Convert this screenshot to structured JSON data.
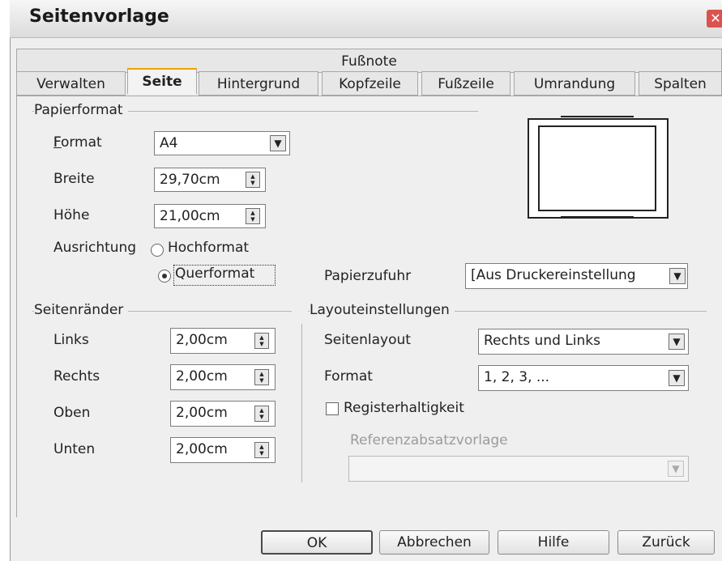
{
  "window": {
    "title": "Seitenvorlage",
    "close_glyph": "✕"
  },
  "tabs": {
    "row1": [
      "Fußnote"
    ],
    "row2": [
      "Verwalten",
      "Seite",
      "Hintergrund",
      "Kopfzeile",
      "Fußzeile",
      "Umrandung",
      "Spalten"
    ],
    "active": "Seite"
  },
  "papierformat": {
    "heading": "Papierformat",
    "format_label": "Format",
    "format_value": "A4",
    "breite_label": "Breite",
    "breite_value": "29,70cm",
    "hoehe_label": "Höhe",
    "hoehe_value": "21,00cm",
    "ausrichtung_label": "Ausrichtung",
    "orientation_options": [
      "Hochformat",
      "Querformat"
    ],
    "orientation_selected": "Querformat",
    "papierzufuhr_label": "Papierzufuhr",
    "papierzufuhr_value": "[Aus Druckereinstellung"
  },
  "seitenraender": {
    "heading": "Seitenränder",
    "links_label": "Links",
    "links_value": "2,00cm",
    "rechts_label": "Rechts",
    "rechts_value": "2,00cm",
    "oben_label": "Oben",
    "oben_value": "2,00cm",
    "unten_label": "Unten",
    "unten_value": "2,00cm"
  },
  "layout": {
    "heading": "Layouteinstellungen",
    "seitenlayout_label": "Seitenlayout",
    "seitenlayout_value": "Rechts und Links",
    "format_label": "Format",
    "format_value": "1, 2, 3, ...",
    "register_label": "Registerhaltigkeit",
    "register_checked": false,
    "referenz_label": "Referenzabsatzvorlage",
    "referenz_value": ""
  },
  "buttons": {
    "ok": "OK",
    "cancel": "Abbrechen",
    "help": "Hilfe",
    "back": "Zurück"
  },
  "icons": {
    "dropdown": "chevron-down-icon",
    "spinner": "spin-updown-icon"
  }
}
